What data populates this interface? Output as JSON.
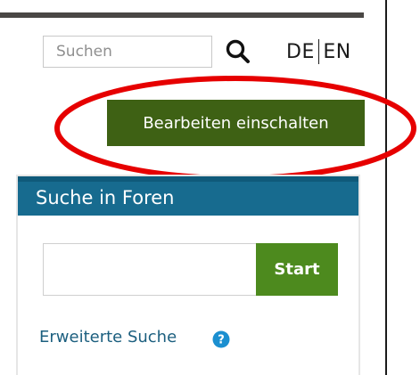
{
  "header": {
    "search": {
      "placeholder": "Suchen",
      "value": ""
    },
    "search_icon": "search-icon",
    "languages": {
      "de_label": "DE",
      "en_label": "EN"
    },
    "edit_button_label": "Bearbeiten einschalten"
  },
  "forum_search_block": {
    "title": "Suche in Foren",
    "input_value": "",
    "start_label": "Start",
    "advanced_search_label": "Erweiterte Suche",
    "help_icon": "help-circle-icon"
  },
  "colors": {
    "edit_button": "#3e6114",
    "start_button": "#4d8a1e",
    "panel_header": "#176b8f",
    "link": "#1c5f7f",
    "annotation": "#e60000"
  }
}
